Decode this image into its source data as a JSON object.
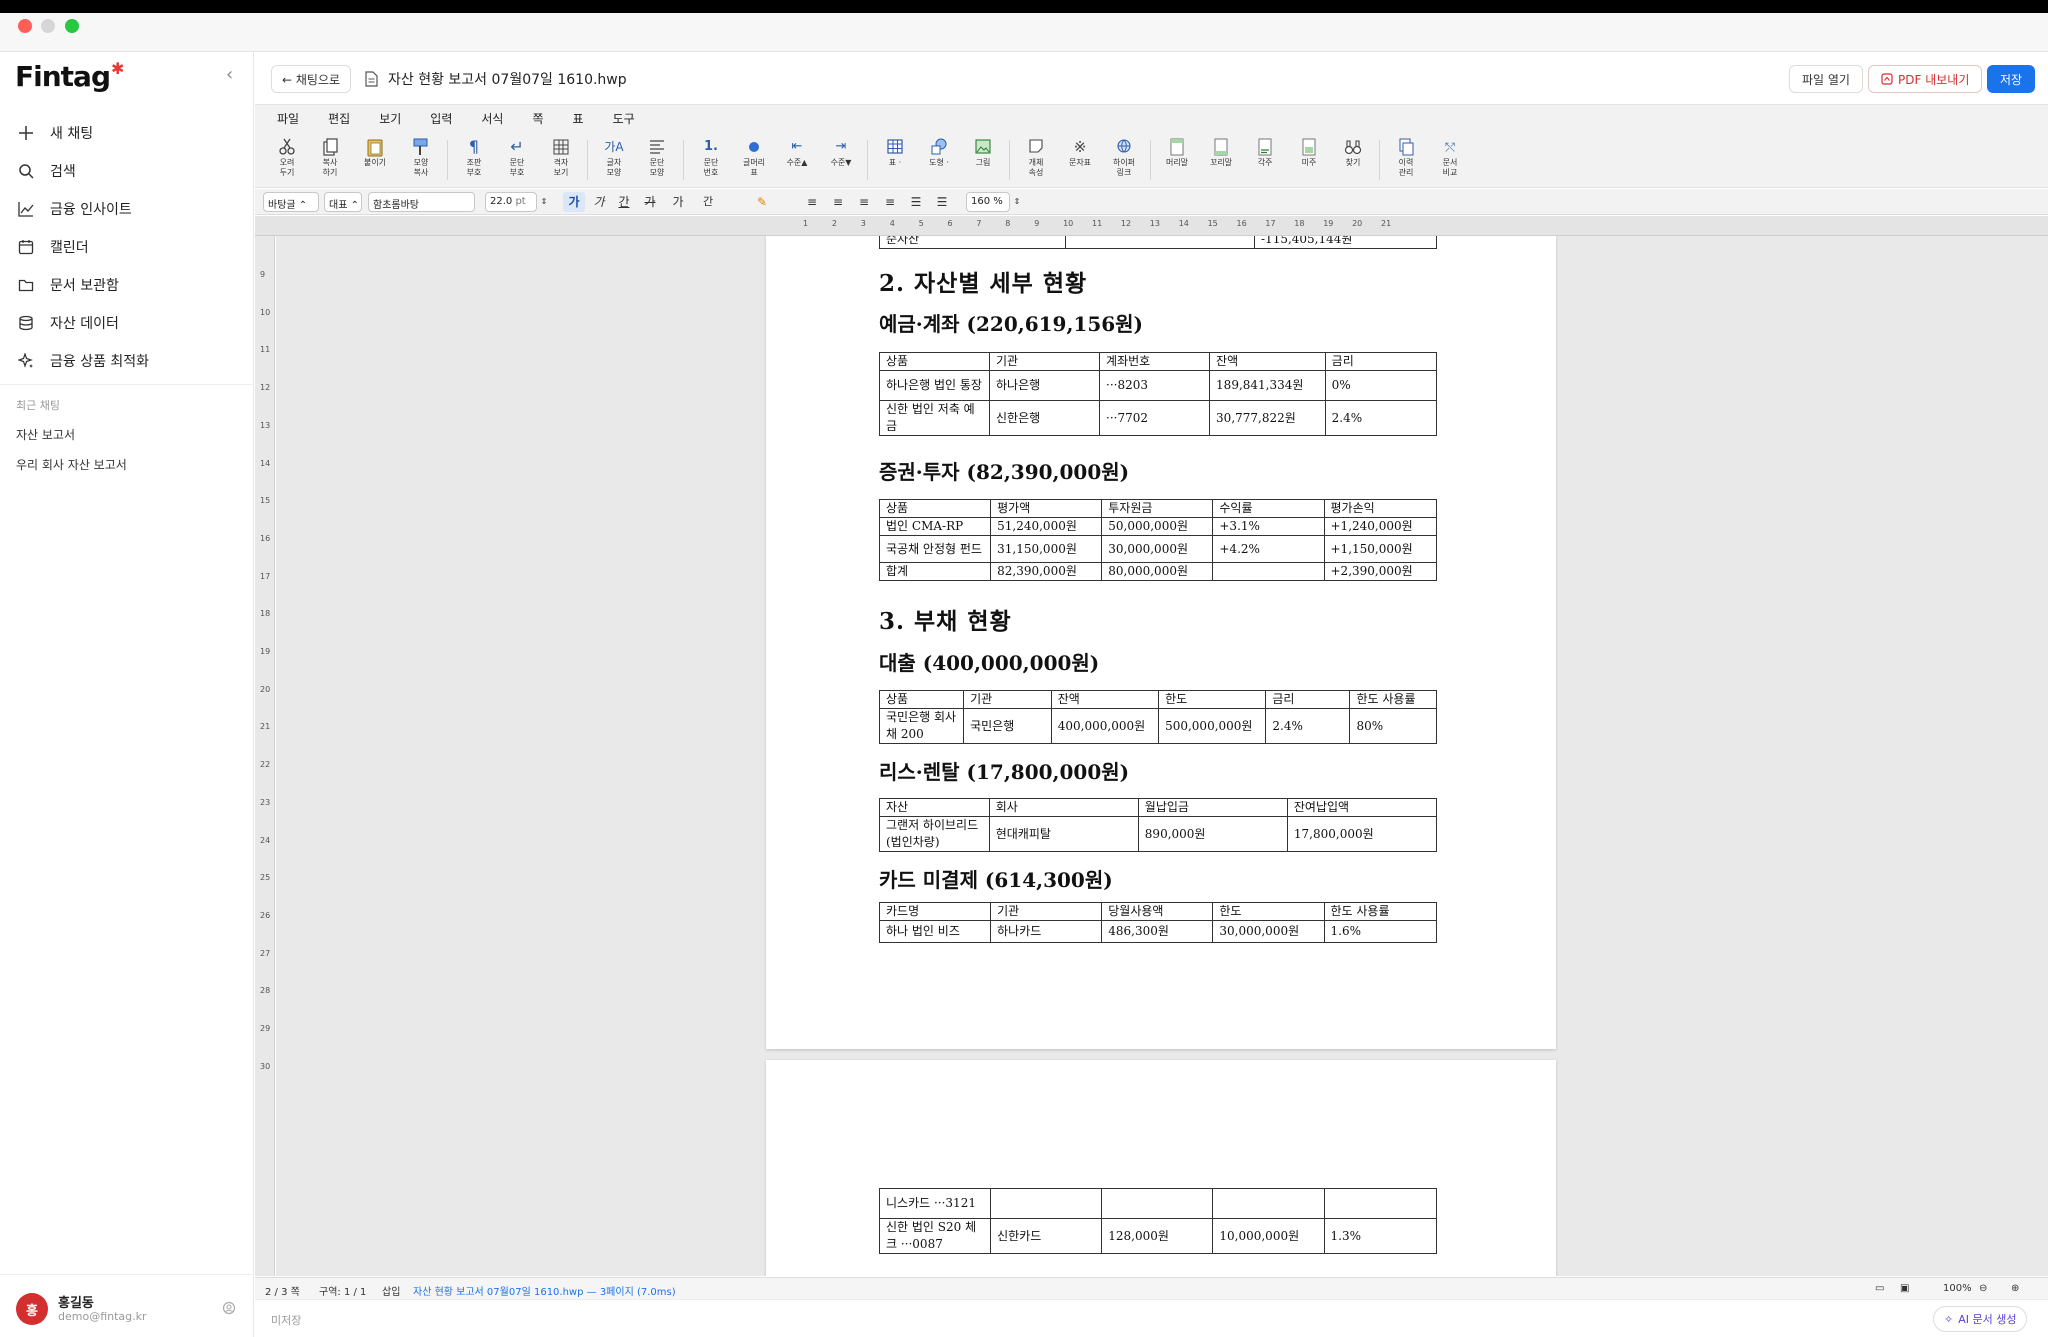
{
  "app": {
    "brand": "Fintag",
    "accent": "#1a73e8",
    "brand_red": "#e53935"
  },
  "sidebar": {
    "items": [
      {
        "label": "새 채팅",
        "icon": "plus-icon"
      },
      {
        "label": "검색",
        "icon": "search-icon"
      },
      {
        "label": "금융 인사이트",
        "icon": "chart-line-icon"
      },
      {
        "label": "캘린더",
        "icon": "calendar-icon"
      },
      {
        "label": "문서 보관함",
        "icon": "folder-icon"
      },
      {
        "label": "자산 데이터",
        "icon": "database-icon"
      },
      {
        "label": "금융 상품 최적화",
        "icon": "sparkle-icon"
      }
    ],
    "recent_heading": "최근 채팅",
    "recent": [
      "자산 보고서",
      "우리 회사 자산 보고서"
    ]
  },
  "user": {
    "initial": "홍",
    "name": "홍길동",
    "email": "demo@fintag.kr"
  },
  "header": {
    "back_label": "← 채팅으로",
    "doc_title": "자산 현황 보고서 07월07일 1610.hwp",
    "open_label": "파일 열기",
    "pdf_label": "PDF 내보내기",
    "save_label": "저장"
  },
  "menu": [
    "파일",
    "편집",
    "보기",
    "입력",
    "서식",
    "쪽",
    "표",
    "도구"
  ],
  "toolbar": [
    [
      "오려",
      "두기"
    ],
    [
      "복사",
      "하기"
    ],
    [
      "붙이기",
      ""
    ],
    [
      "모양",
      "복사"
    ],
    [
      "조판",
      "부호"
    ],
    [
      "문단",
      "부호"
    ],
    [
      "격자",
      "보기"
    ],
    [
      "글자",
      "모양"
    ],
    [
      "문단",
      "모양"
    ],
    [
      "문단",
      "번호"
    ],
    [
      "글머리",
      "표"
    ],
    [
      "수준▲",
      ""
    ],
    [
      "수준▼",
      ""
    ],
    [
      "표 ·",
      ""
    ],
    [
      "도형 ·",
      ""
    ],
    [
      "그림",
      ""
    ],
    [
      "개체",
      "속성"
    ],
    [
      "문자표",
      ""
    ],
    [
      "하이퍼",
      "링크"
    ],
    [
      "머리말",
      ""
    ],
    [
      "꼬리말",
      ""
    ],
    [
      "각주",
      ""
    ],
    [
      "미주",
      ""
    ],
    [
      "찾기",
      ""
    ],
    [
      "이력",
      "관리"
    ],
    [
      "문서",
      "비교"
    ]
  ],
  "format": {
    "style": "바탕글",
    "lang": "대표",
    "font": "함초롬바탕",
    "size": "22.0",
    "unit": "pt",
    "bold": "가",
    "italic": "가",
    "underline": "간",
    "strike": "가",
    "super": "가",
    "sub": "간",
    "zoom_para": "160 %"
  },
  "document": {
    "top_row": [
      "순자산",
      "",
      "-115,405,144원"
    ],
    "section2": "2. 자산별 세부 현황",
    "deposits": {
      "title": "예금·계좌 (220,619,156원)",
      "headers": [
        "상품",
        "기관",
        "계좌번호",
        "잔액",
        "금리"
      ],
      "rows": [
        [
          "하나은행 법인 통장",
          "하나은행",
          "···8203",
          "189,841,334원",
          "0%"
        ],
        [
          "신한 법인 저축 예금",
          "신한은행",
          "···7702",
          "30,777,822원",
          "2.4%"
        ]
      ]
    },
    "securities": {
      "title": "증권·투자 (82,390,000원)",
      "headers": [
        "상품",
        "평가액",
        "투자원금",
        "수익률",
        "평가손익"
      ],
      "rows": [
        [
          "법인 CMA-RP",
          "51,240,000원",
          "50,000,000원",
          "+3.1%",
          "+1,240,000원"
        ],
        [
          "국공채 안정형 펀드",
          "31,150,000원",
          "30,000,000원",
          "+4.2%",
          "+1,150,000원"
        ],
        [
          "합계",
          "82,390,000원",
          "80,000,000원",
          "",
          "+2,390,000원"
        ]
      ]
    },
    "section3": "3. 부채 현황",
    "loans": {
      "title": "대출 (400,000,000원)",
      "headers": [
        "상품",
        "기관",
        "잔액",
        "한도",
        "금리",
        "한도 사용률"
      ],
      "rows": [
        [
          "국민은행 회사채 200",
          "국민은행",
          "400,000,000원",
          "500,000,000원",
          "2.4%",
          "80%"
        ]
      ]
    },
    "lease": {
      "title": "리스·렌탈 (17,800,000원)",
      "headers": [
        "자산",
        "회사",
        "월납입금",
        "잔여납입액"
      ],
      "rows": [
        [
          "그랜저 하이브리드 (법인차량)",
          "현대캐피탈",
          "890,000원",
          "17,800,000원"
        ]
      ]
    },
    "cards": {
      "title": "카드 미결제 (614,300원)",
      "headers": [
        "카드명",
        "기관",
        "당월사용액",
        "한도",
        "한도 사용률"
      ],
      "rows": [
        [
          "하나 법인 비즈",
          "하나카드",
          "486,300원",
          "30,000,000원",
          "1.6%"
        ]
      ],
      "page2_rows": [
        [
          "니스카드 ···3121",
          "",
          "",
          "",
          ""
        ],
        [
          "신한 법인 S20 체크 ···0087",
          "신한카드",
          "128,000원",
          "10,000,000원",
          "1.3%"
        ]
      ]
    }
  },
  "status": {
    "page": "2 / 3 쪽",
    "section": "구역: 1 / 1",
    "mode": "삽입",
    "info": "자산 현황 보고서 07월07일 1610.hwp — 3페이지 (7.0ms)",
    "zoom": "100%"
  },
  "bottom": {
    "unsaved": "미저장",
    "ai_label": "AI 문서 생성"
  }
}
